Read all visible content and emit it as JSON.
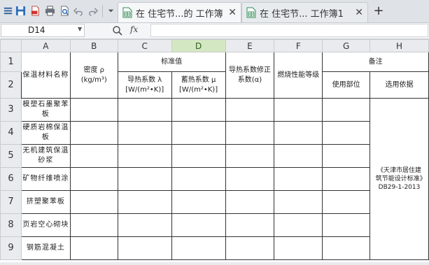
{
  "toolbar": {
    "tabs": [
      {
        "label": "在 住宅节...的 工作簿",
        "active": true
      },
      {
        "label": "在 住宅节... 工作簿1",
        "active": false
      }
    ],
    "new_tab": "+",
    "close": "✕"
  },
  "formula_bar": {
    "name_box": "D14",
    "fx": "fx",
    "formula": ""
  },
  "grid": {
    "columns": [
      "A",
      "B",
      "C",
      "D",
      "E",
      "F",
      "G",
      "H"
    ],
    "selected_column": "D",
    "rows": [
      "1",
      "2",
      "3",
      "4",
      "5",
      "6",
      "7",
      "8",
      "9"
    ],
    "header": {
      "a": "保温材料名称",
      "b_line1": "密度 ρ",
      "b_line2": "(kg/m³)",
      "cd": "标准值",
      "c_line1": "导热系数 λ",
      "c_line2": "[W/(m²•K)]",
      "d_line1": "蓄热系数 μ",
      "d_line2": "[W/(m²•K)]",
      "e": "导热系数修正系数(α)",
      "f": "燃烧性能等级",
      "gh": "备注",
      "g": "使用部位",
      "h": "选用依据"
    },
    "materials": [
      "模塑石墨聚苯板",
      "硬质岩棉保温板",
      "无机建筑保温砂浆",
      "矿物纤维喷涂",
      "挤塑聚苯板",
      "页岩空心砌块",
      "钢筋混凝土"
    ],
    "basis": "《天津市居住建筑节能设计标准》DB29-1-2013"
  },
  "colors": {
    "selected_header": "#d4e7c3",
    "header_bg": "#e9ebee",
    "toolbar_bg": "#dfe3e8"
  }
}
